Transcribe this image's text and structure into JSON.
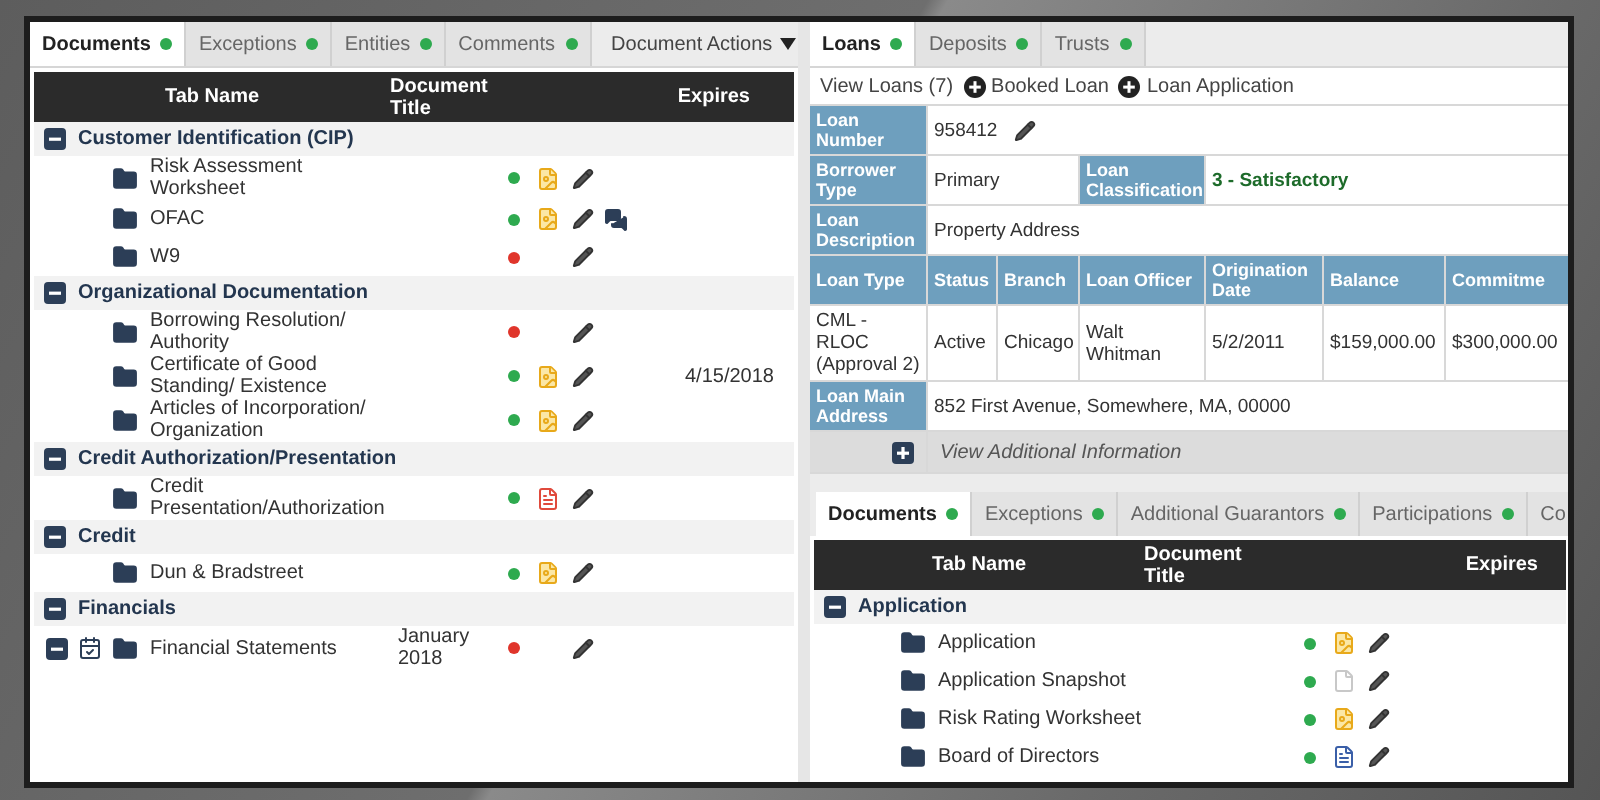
{
  "left": {
    "tabs": [
      {
        "label": "Documents",
        "selected": true
      },
      {
        "label": "Exceptions",
        "selected": false
      },
      {
        "label": "Entities",
        "selected": false
      },
      {
        "label": "Comments",
        "selected": false
      }
    ],
    "actions": "Document Actions",
    "columns": [
      "Tab Name",
      "Document Title",
      "Expires"
    ],
    "groups": [
      {
        "title": "Customer Identification (CIP)",
        "expanded": true,
        "items": [
          {
            "name": "Risk Assessment Worksheet",
            "kind": "plain",
            "color": "#2eaa4f",
            "attachment": {
              "kind": "image"
            },
            "comment": false
          },
          {
            "name": "OFAC",
            "kind": "plain",
            "color": "#2eaa4f",
            "attachment": {
              "kind": "image"
            },
            "comment": true
          },
          {
            "name": "W9",
            "kind": "plain",
            "color": "#e0352b",
            "comment": false
          }
        ]
      },
      {
        "title": "Organizational Documentation",
        "expanded": true,
        "items": [
          {
            "name": "Borrowing Resolution/ Authority",
            "kind": "plain",
            "color": "#e0352b",
            "comment": false
          },
          {
            "name": "Certificate of Good Standing/ Existence",
            "kind": "plain",
            "color": "#2eaa4f",
            "attachment": {
              "kind": "image"
            },
            "comment": false,
            "expires": "4/15/2018"
          },
          {
            "name": "Articles of Incorporation/ Organization",
            "kind": "plain",
            "color": "#2eaa4f",
            "attachment": {
              "kind": "image"
            },
            "comment": false
          }
        ]
      },
      {
        "title": "Credit Authorization/Presentation",
        "expanded": true,
        "items": [
          {
            "name": "Credit Presentation/Authorization",
            "kind": "plain",
            "color": "#2eaa4f",
            "attachment": {
              "kind": "pdf"
            },
            "comment": false
          }
        ]
      },
      {
        "title": "Credit",
        "expanded": true,
        "items": [
          {
            "name": "Dun & Bradstreet",
            "kind": "plain",
            "color": "#2eaa4f",
            "attachment": {
              "kind": "image"
            },
            "comment": false
          }
        ]
      },
      {
        "title": "Financials",
        "expanded": true,
        "items": [
          {
            "name": "Financial Statements",
            "kind": "recurring",
            "expanded": true,
            "title": "January 2018",
            "color": "#e0352b",
            "comment": false
          }
        ]
      }
    ]
  },
  "right": {
    "tabs": [
      {
        "label": "Loans",
        "selected": true
      },
      {
        "label": "Deposits",
        "selected": false
      },
      {
        "label": "Trusts",
        "selected": false
      }
    ],
    "links": [
      {
        "label": "View Loans (7)",
        "kind": "link"
      },
      {
        "label": "Booked Loan",
        "kind": "add"
      },
      {
        "label": "Loan Application",
        "kind": "add"
      }
    ],
    "loan": {
      "number": {
        "label": "Loan Number",
        "value": "958412"
      },
      "borrower_type": {
        "label": "Borrower Type",
        "value": "Primary"
      },
      "classification": {
        "label": "Loan Classification",
        "value": "3 - Satisfactory"
      },
      "description": {
        "label": "Loan Description",
        "value": "Property Address"
      },
      "columns": [
        "Loan Type",
        "Status",
        "Branch",
        "Loan Officer",
        "Origination Date",
        "Balance",
        "Commitme"
      ],
      "row": [
        "CML - RLOC (Approval 2)",
        "Active",
        "Chicago",
        "Walt Whitman",
        "5/2/2011",
        "$159,000.00",
        "$300,000.00"
      ],
      "address": {
        "label": "Loan Main Address",
        "value": "852 First Avenue, Somewhere, MA, 00000"
      },
      "more": "View Additional Information"
    },
    "doc_tabs": [
      {
        "label": "Documents",
        "selected": true,
        "dot": true
      },
      {
        "label": "Exceptions",
        "selected": false,
        "dot": true
      },
      {
        "label": "Additional Guarantors",
        "selected": false,
        "dot": true
      },
      {
        "label": "Participations",
        "selected": false,
        "dot": true
      },
      {
        "label": "Co",
        "selected": false,
        "dot": false
      }
    ],
    "columns": [
      "Tab Name",
      "Document Title",
      "Expires"
    ],
    "groups": [
      {
        "title": "Application",
        "expanded": true,
        "items": [
          {
            "name": "Application",
            "kind": "plain",
            "color": "#2eaa4f",
            "attachment": {
              "kind": "image"
            },
            "comment": false
          },
          {
            "name": "Application Snapshot",
            "kind": "plain",
            "color": "#2eaa4f",
            "attachment": {
              "kind": "blank"
            },
            "comment": false
          },
          {
            "name": "Risk Rating Worksheet",
            "kind": "plain",
            "color": "#2eaa4f",
            "attachment": {
              "kind": "image"
            },
            "comment": false
          },
          {
            "name": "Board of Directors",
            "kind": "plain",
            "color": "#2eaa4f",
            "attachment": {
              "kind": "word"
            },
            "comment": false
          }
        ]
      }
    ]
  }
}
